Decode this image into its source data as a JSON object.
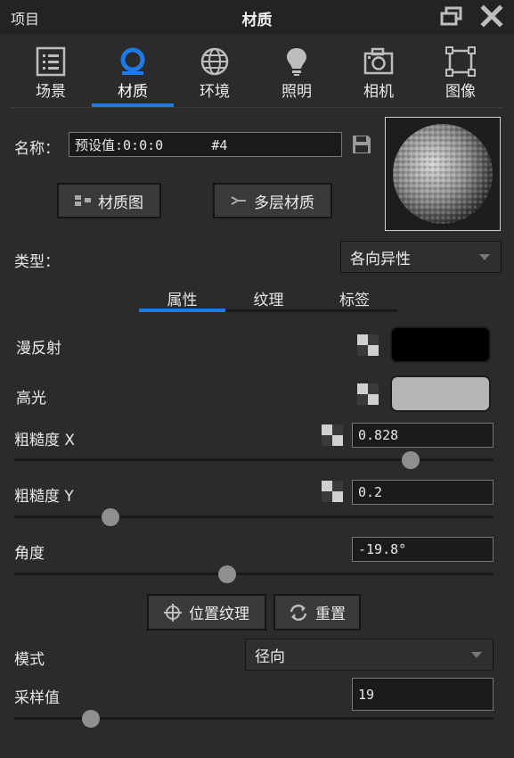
{
  "titlebar": {
    "left_label": "项目",
    "title": "材质"
  },
  "tabs": [
    {
      "label": "场景",
      "icon": "list-icon"
    },
    {
      "label": "材质",
      "icon": "material-icon",
      "active": true
    },
    {
      "label": "环境",
      "icon": "globe-icon"
    },
    {
      "label": "照明",
      "icon": "bulb-icon"
    },
    {
      "label": "相机",
      "icon": "camera-icon"
    },
    {
      "label": "图像",
      "icon": "image-frame-icon"
    }
  ],
  "name": {
    "label": "名称：",
    "value": "预设值:0:0:0      #4"
  },
  "buttons": {
    "material_graph": "材质图",
    "multilayer": "多层材质",
    "position_texture": "位置纹理",
    "reset": "重置"
  },
  "type": {
    "label": "类型：",
    "value": "各向异性"
  },
  "subtabs": [
    "属性",
    "纹理",
    "标签"
  ],
  "props": {
    "diffuse": {
      "label": "漫反射",
      "color": "#000000"
    },
    "specular": {
      "label": "高光",
      "color": "#b5b5b5"
    },
    "roughness_x": {
      "label": "粗糙度 X",
      "value": "0.828",
      "fraction": 0.828
    },
    "roughness_y": {
      "label": "粗糙度 Y",
      "value": "0.2",
      "fraction": 0.2
    },
    "angle": {
      "label": "角度",
      "value": "-19.8°",
      "fraction": 0.445
    },
    "mode": {
      "label": "模式",
      "value": "径向"
    },
    "samples": {
      "label": "采样值",
      "value": "19",
      "fraction": 0.16
    }
  },
  "accent": "#1e7be6"
}
